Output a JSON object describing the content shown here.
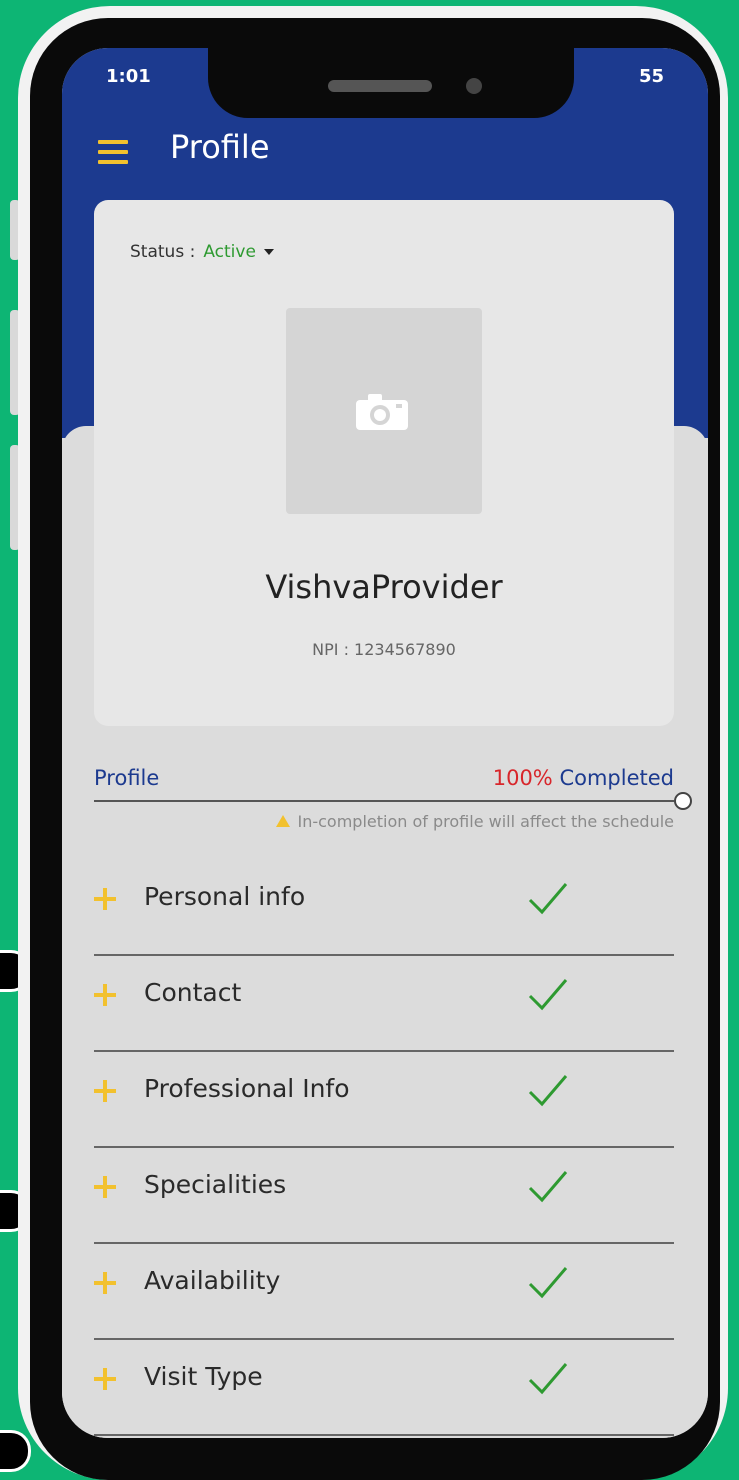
{
  "statusbar": {
    "time": "1:01",
    "right": "55"
  },
  "header": {
    "title": "Profile",
    "menu_icon": "hamburger-menu-icon"
  },
  "profile_card": {
    "status_label": "Status :",
    "status_value": "Active",
    "photo_icon": "camera-icon",
    "name": "VishvaProvider",
    "npi": "NPI : 1234567890"
  },
  "progress": {
    "label": "Profile",
    "percent_text": "100%",
    "completed_text": "Completed",
    "value": 1.0,
    "warning": "In-completion of profile will affect the schedule"
  },
  "sections": [
    {
      "label": "Personal info",
      "complete": true
    },
    {
      "label": "Contact",
      "complete": true
    },
    {
      "label": "Professional Info",
      "complete": true
    },
    {
      "label": "Specialities",
      "complete": true
    },
    {
      "label": "Availability",
      "complete": true
    },
    {
      "label": "Visit Type",
      "complete": true
    }
  ],
  "colors": {
    "background": "#0db574",
    "header_blue": "#1c3a8f",
    "accent_yellow": "#f2c12e",
    "active_green": "#2e9a31",
    "percent_red": "#d8262b",
    "check_green": "#2e9a31"
  }
}
